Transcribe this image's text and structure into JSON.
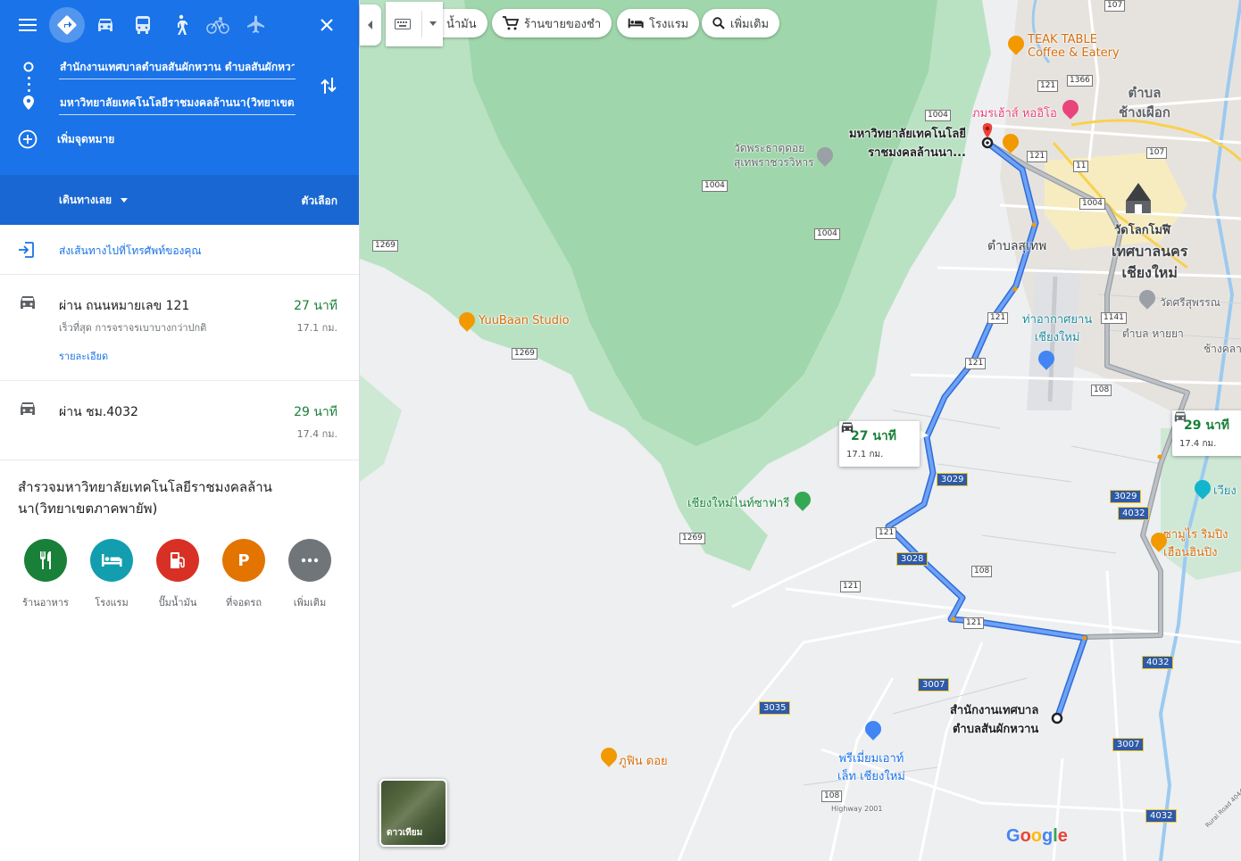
{
  "directions": {
    "origin_value": "สำนักงานเทศบาลตำบลสันผักหวาน ตำบลสันผักหวาน",
    "destination_value": "มหาวิทยาลัยเทคโนโลยีราชมงคลล้านนา(วิทยาเขตภาคพายัพ)",
    "add_destination_label": "เพิ่มจุดหมาย",
    "leave_now_label": "เดินทางเลย",
    "options_label": "ตัวเลือก",
    "send_to_phone_label": "ส่งเส้นทางไปที่โทรศัพท์ของคุณ",
    "modes": [
      "directions-icon",
      "car-icon",
      "transit-icon",
      "walk-icon",
      "bicycle-icon",
      "flight-icon"
    ]
  },
  "routes": [
    {
      "via": "ผ่าน ถนนหมายเลข 121",
      "desc": "เร็วที่สุด การจราจรเบาบางกว่าปกติ",
      "details_label": "รายละเอียด",
      "time": "27 นาที",
      "distance": "17.1 กม."
    },
    {
      "via": "ผ่าน ชม.4032",
      "time": "29 นาที",
      "distance": "17.4 กม."
    }
  ],
  "explore": {
    "title": "สำรวจมหาวิทยาลัยเทคโนโลยีราชมงคลล้านนา(วิทยาเขตภาคพายัพ)",
    "categories": [
      {
        "label": "ร้านอาหาร",
        "icon": "restaurant-icon",
        "color": "#188038"
      },
      {
        "label": "โรงแรม",
        "icon": "hotel-icon",
        "color": "#129eaf"
      },
      {
        "label": "ปั๊มน้ำมัน",
        "icon": "gas-station-icon",
        "color": "#d93025"
      },
      {
        "label": "ที่จอดรถ",
        "icon": "parking-icon",
        "parking_letter": "P",
        "color": "#e37400"
      },
      {
        "label": "เพิ่มเติม",
        "icon": "more-icon",
        "color": "#70757a"
      }
    ]
  },
  "map_chips": [
    {
      "label": "น้ำมัน",
      "icon": "gas-icon"
    },
    {
      "label": "ร้านขายของชำ",
      "icon": "cart-icon"
    },
    {
      "label": "โรงแรม",
      "icon": "hotel-icon"
    },
    {
      "label": "เพิ่มเติม",
      "icon": "search-icon"
    }
  ],
  "map": {
    "callout_main": {
      "time": "27 นาที",
      "distance": "17.1 กม."
    },
    "callout_alt": {
      "time": "29 นาที",
      "distance": "17.4 กม."
    },
    "destination_label_line1": "มหาวิทยาลัยเทคโนโลยี",
    "destination_label_line2": "ราชมงคลล้านนา...",
    "origin_label_line1": "สำนักงานเทศบาล",
    "origin_label_line2": "ตำบลสันผักหวาน",
    "places": {
      "teak_table_1": "TEAK TABLE",
      "teak_table_2": "Coffee & Eatery",
      "phamorn": "ภมรเฮ้าส์ หออิโอ",
      "tambon_chang_phueak_1": "ตำบล",
      "tambon_chang_phueak_2": "ช้างเผือก",
      "wat_phra_that_1": "วัดพระธาตุดอย",
      "wat_phra_that_2": "สุเทพราชวรวิหาร",
      "wat_lok_molee": "วัดโลกโมฬี",
      "tambon_suthep": "ตำบลสุเทพ",
      "chiang_mai_1": "เทศบาลนคร",
      "chiang_mai_2": "เชียงใหม่",
      "yuubaan": "YuuBaan Studio",
      "airport_1": "ท่าอากาศยาน",
      "airport_2": "เชียงใหม่",
      "wat_sri_suphan": "วัดศรีสุพรรณ",
      "tambon_haiya": "ตำบล หายยา",
      "chang_khlan": "ช้างคลา",
      "night_safari": "เชียงใหม่ไนท์ซาฟารี",
      "samurai_1": "ซามูไร ริมปิง",
      "samurai_2": "เฮือนฮินปิง",
      "wiang": "เวียง",
      "premium_outlet_1": "พรีเมี่ยมเอาท์",
      "premium_outlet_2": "เล็ท เชียงใหม่",
      "phufin": "ภูฟิน ดอย",
      "highway_2001": "Highway 2001",
      "ring_road": "Rural Road 4044"
    },
    "shields_white": [
      "107",
      "1366",
      "121",
      "1004",
      "121",
      "11",
      "107",
      "1004",
      "1004",
      "1004",
      "1269",
      "1141",
      "121",
      "121",
      "108",
      "1269",
      "1269",
      "121",
      "108",
      "121",
      "121",
      "108"
    ],
    "shields_yellow": [
      "3029",
      "3029",
      "4032",
      "3028",
      "3007",
      "3035",
      "4032",
      "3007",
      "4032"
    ],
    "satellite_label": "ดาวเทียม",
    "google_logo": "Google"
  },
  "colors": {
    "header_blue": "#1a73e8",
    "subheader_blue": "#1967d2",
    "route_blue": "#4285f4",
    "alt_route_gray": "#a3a7ab",
    "time_green": "#188038",
    "forest_green": "#a8dab5"
  }
}
